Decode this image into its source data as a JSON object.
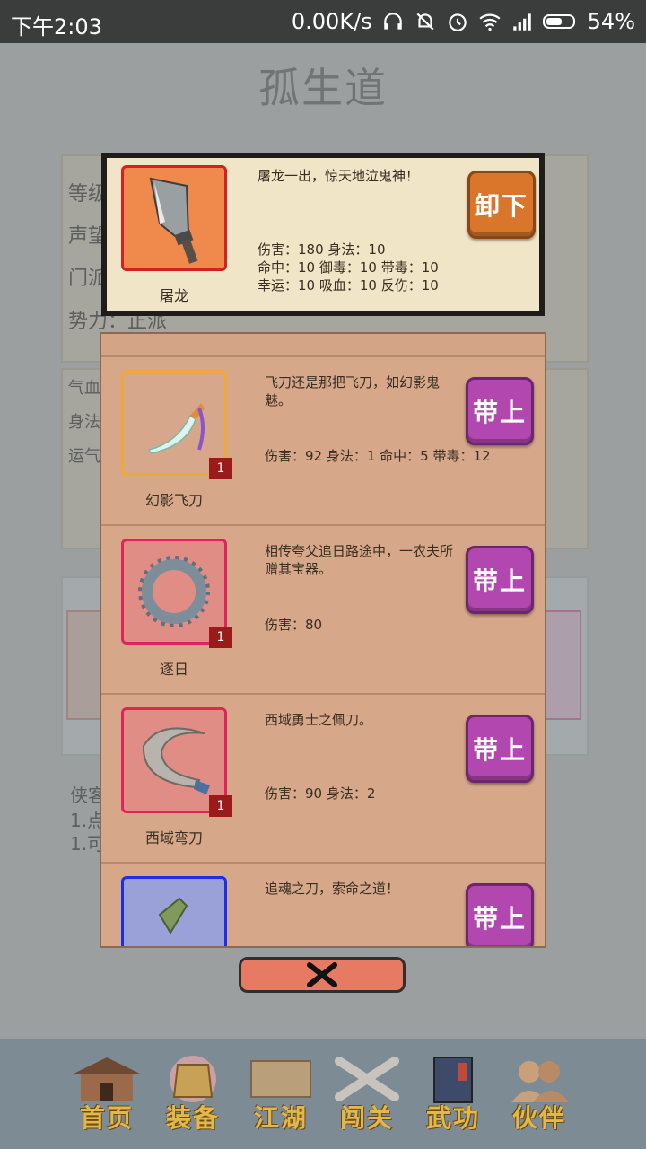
{
  "status_bar": {
    "time": "下午2:03",
    "speed": "0.00K/s",
    "battery": "54%"
  },
  "page": {
    "title": "孤生道",
    "labels": [
      "等级",
      "声望",
      "门派",
      "势力：正派",
      "气血",
      "身法",
      "运气",
      "侠客",
      "1.点",
      "1.可"
    ]
  },
  "equipped": {
    "name": "屠龙",
    "description": "屠龙一出，惊天地泣鬼神！",
    "stats": [
      "伤害：180 身法：10",
      "命中：10 御毒：10 带毒：10",
      "幸运：10 吸血：10 反伤：10"
    ],
    "button_label": "卸下"
  },
  "inventory": [
    {
      "name": "幻影飞刀",
      "description": "飞刀还是那把飞刀，如幻影鬼魅。",
      "stats": "伤害：92 身法：1 命中：5 带毒：12",
      "count": "1",
      "button_label": "带上",
      "frame_color": "#f0a83c"
    },
    {
      "name": "逐日",
      "description": "相传夸父追日路途中，一农夫所赠其宝器。",
      "stats": "伤害：80",
      "count": "1",
      "button_label": "带上",
      "frame_color": "#e0245a"
    },
    {
      "name": "西域弯刀",
      "description": "西域勇士之佩刀。",
      "stats": "伤害：90 身法：2",
      "count": "1",
      "button_label": "带上",
      "frame_color": "#e0245a"
    },
    {
      "name": "",
      "description": "追魂之刀，索命之道！",
      "stats": "",
      "count": "",
      "button_label": "带上",
      "frame_color": "#1a2ef0"
    }
  ],
  "close_icon": "x-icon",
  "bottom_nav": [
    {
      "label": "首页",
      "icon": "house-icon"
    },
    {
      "label": "装备",
      "icon": "armor-icon"
    },
    {
      "label": "江湖",
      "icon": "scroll-map-icon"
    },
    {
      "label": "闯关",
      "icon": "crossed-swords-icon"
    },
    {
      "label": "武功",
      "icon": "book-icon"
    },
    {
      "label": "伙伴",
      "icon": "partners-icon"
    }
  ]
}
